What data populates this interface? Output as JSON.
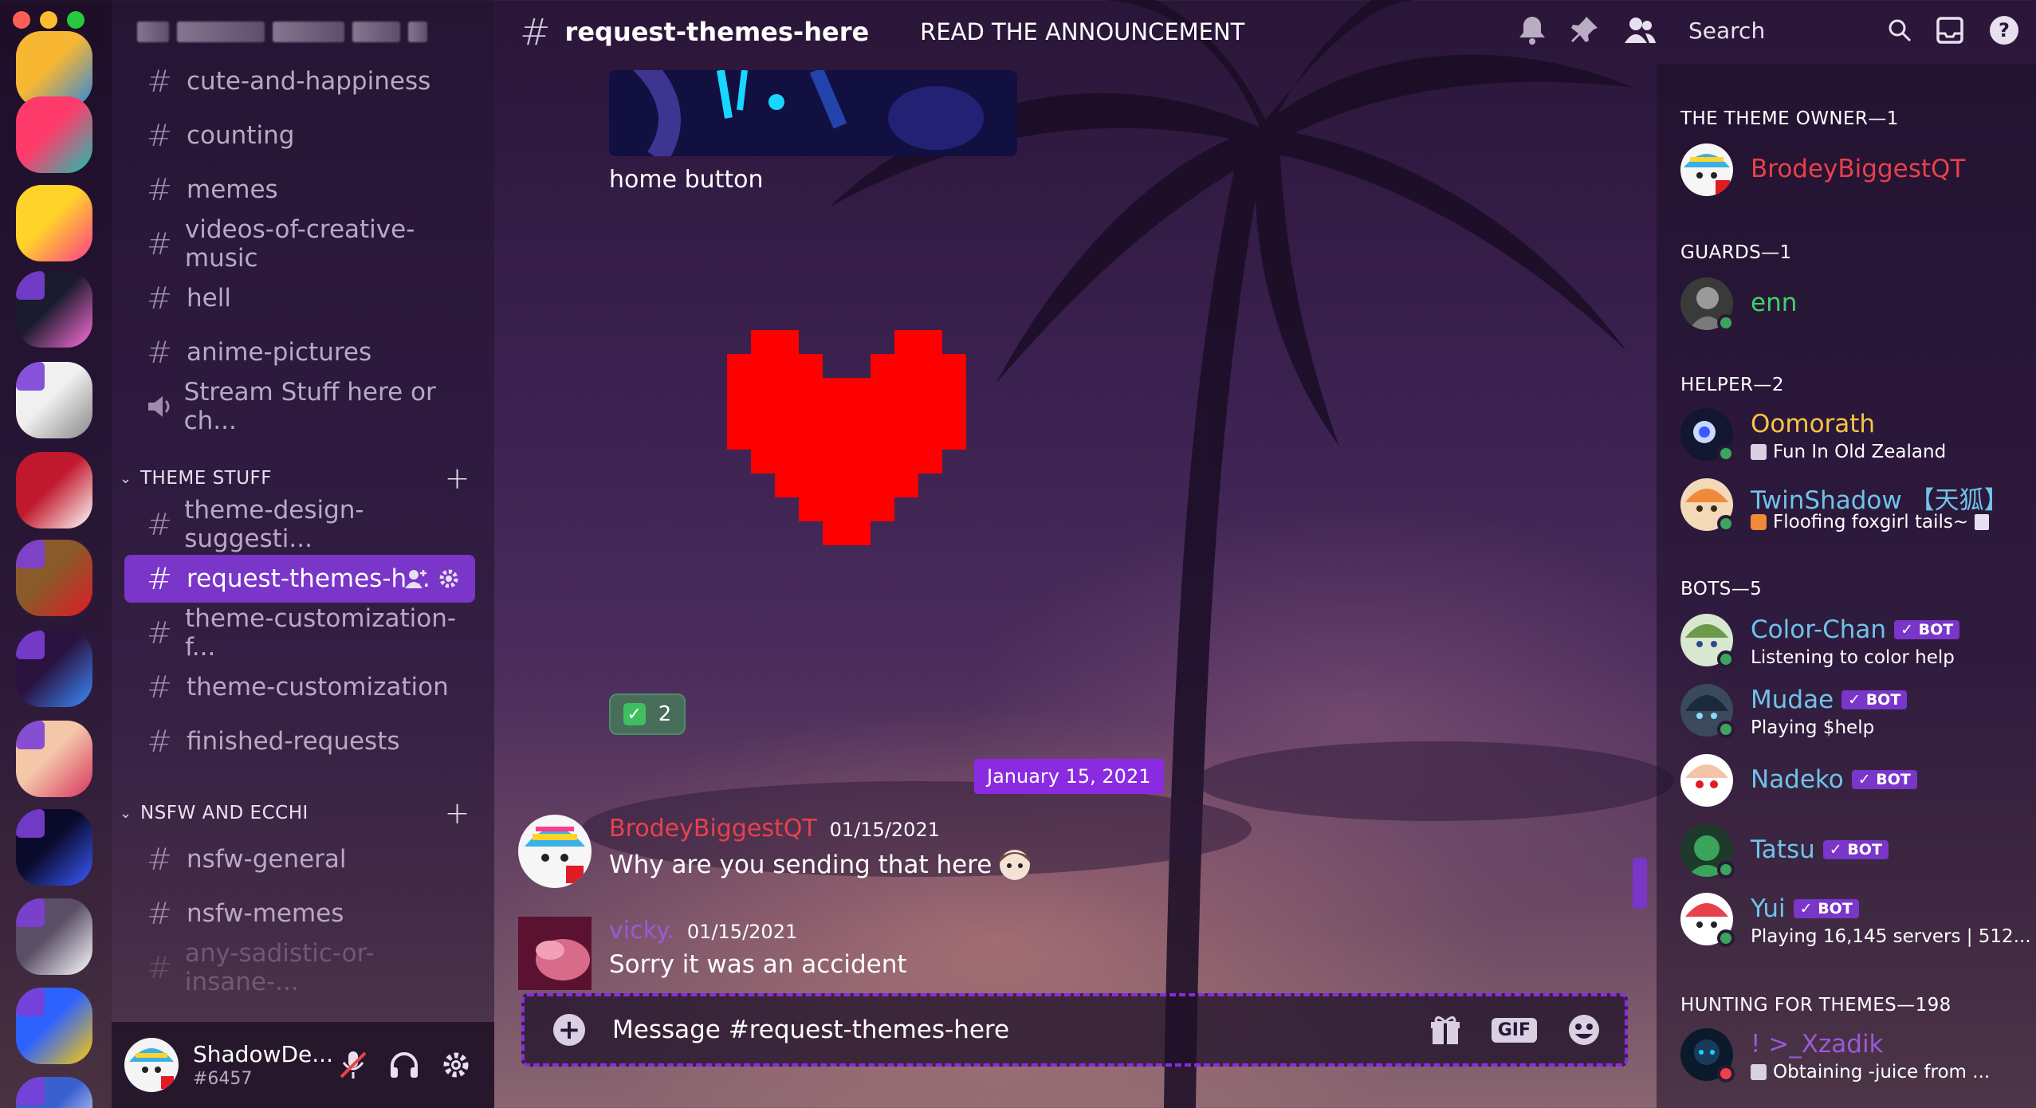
{
  "window": {
    "traffic_colors": [
      "#ff5f57",
      "#febc2e",
      "#28c840"
    ]
  },
  "server_rail": {
    "servers": [
      {
        "name": "just-dance-top",
        "color_a": "#f7b733",
        "color_b": "#2e86de"
      },
      {
        "name": "just-dance-community",
        "color_a": "#ff3b6b",
        "color_b": "#19c3b1"
      },
      {
        "name": "just-dance-2021",
        "color_a": "#ffd32a",
        "color_b": "#ff3b8b"
      },
      {
        "name": "rainbow-penguin",
        "color_a": "#1b1b2f",
        "color_b": "#ff6fd8"
      },
      {
        "name": "manga-girl",
        "color_a": "#f0f0f0",
        "color_b": "#888888"
      },
      {
        "name": "santa-girl",
        "color_a": "#c0182c",
        "color_b": "#ffffff"
      },
      {
        "name": "heart-dog",
        "color_a": "#8a5a2b",
        "color_b": "#e01b24"
      },
      {
        "name": "blue-heart",
        "color_a": "#2a1240",
        "color_b": "#3b8cff"
      },
      {
        "name": "kiss-girl",
        "color_a": "#f3c7a8",
        "color_b": "#d8345f"
      },
      {
        "name": "dark-anime",
        "color_a": "#0a0a2a",
        "color_b": "#3b5bff"
      },
      {
        "name": "discord",
        "color_a": "#5a4e66",
        "color_b": "#ffffff"
      },
      {
        "name": "dance-group",
        "color_a": "#2e62ff",
        "color_b": "#ffcc00"
      },
      {
        "name": "partial-server",
        "color_a": "#3a5fcf",
        "color_b": "#ffffff"
      }
    ]
  },
  "sidebar": {
    "channels_top": [
      {
        "label": "cute-and-happiness"
      },
      {
        "label": "counting"
      },
      {
        "label": "memes"
      },
      {
        "label": "videos-of-creative-music"
      },
      {
        "label": "hell"
      },
      {
        "label": "anime-pictures"
      }
    ],
    "voice_channel": {
      "label": "Stream Stuff here or ch..."
    },
    "category_theme": {
      "label": "THEME STUFF"
    },
    "channels_theme": [
      {
        "label": "theme-design-suggesti..."
      },
      {
        "label": "request-themes-h...",
        "active": true
      },
      {
        "label": "theme-customization-f..."
      },
      {
        "label": "theme-customization"
      },
      {
        "label": "finished-requests"
      }
    ],
    "category_nsfw": {
      "label": "NSFW AND ECCHI"
    },
    "channels_nsfw": [
      {
        "label": "nsfw-general"
      },
      {
        "label": "nsfw-memes"
      },
      {
        "label": "any-sadistic-or-insane-..."
      }
    ]
  },
  "user_panel": {
    "username": "ShadowDe...",
    "tag": "#6457"
  },
  "topbar": {
    "channel_name": "request-themes-here",
    "topic": "READ THE ANNOUNCEMENT",
    "search_placeholder": "Search"
  },
  "chat": {
    "attachment_caption": "home button",
    "reaction_count": "2",
    "date_divider": "January 15, 2021",
    "messages": [
      {
        "author": "BrodeyBiggestQT",
        "author_color": "#e8414b",
        "time": "01/15/2021",
        "text": "Why are you sending that here"
      },
      {
        "author": "vicky.",
        "author_color": "#9b59d6",
        "time": "01/15/2021",
        "text": "Sorry it was an accident"
      }
    ],
    "composer_placeholder": "Message #request-themes-here",
    "gif_label": "GIF",
    "accent": "#8a2be2"
  },
  "members": {
    "groups": [
      {
        "header": "THE THEME OWNER—1",
        "members": [
          {
            "name": "BrodeyBiggestQT",
            "color": "#e8414b"
          }
        ]
      },
      {
        "header": "GUARDS—1",
        "members": [
          {
            "name": "enn",
            "color": "#3fd16b"
          }
        ]
      },
      {
        "header": "HELPER—2",
        "members": [
          {
            "name": "Oomorath",
            "color": "#f5c542",
            "activity": "Fun In Old Zealand"
          },
          {
            "name": "TwinShadow 【天狐】",
            "color": "#6fc3e8",
            "activity": "Floofing foxgirl tails~"
          }
        ]
      },
      {
        "header": "BOTS—5",
        "members": [
          {
            "name": "Color-Chan",
            "color": "#6fc3e8",
            "bot": "BOT",
            "activity": "Listening to color help"
          },
          {
            "name": "Mudae",
            "color": "#6fc3e8",
            "bot": "BOT",
            "activity": "Playing $help"
          },
          {
            "name": "Nadeko",
            "color": "#6fc3e8",
            "bot": "BOT"
          },
          {
            "name": "Tatsu",
            "color": "#6fc3e8",
            "bot": "BOT"
          },
          {
            "name": "Yui",
            "color": "#6fc3e8",
            "bot": "BOT",
            "activity": "Playing 16,145 servers | 512..."
          }
        ]
      },
      {
        "header": "HUNTING FOR THEMES—198",
        "members": [
          {
            "name": "! >_Xzadik",
            "color": "#9b59d6",
            "activity": "Obtaining -juice from ..."
          }
        ]
      }
    ]
  }
}
